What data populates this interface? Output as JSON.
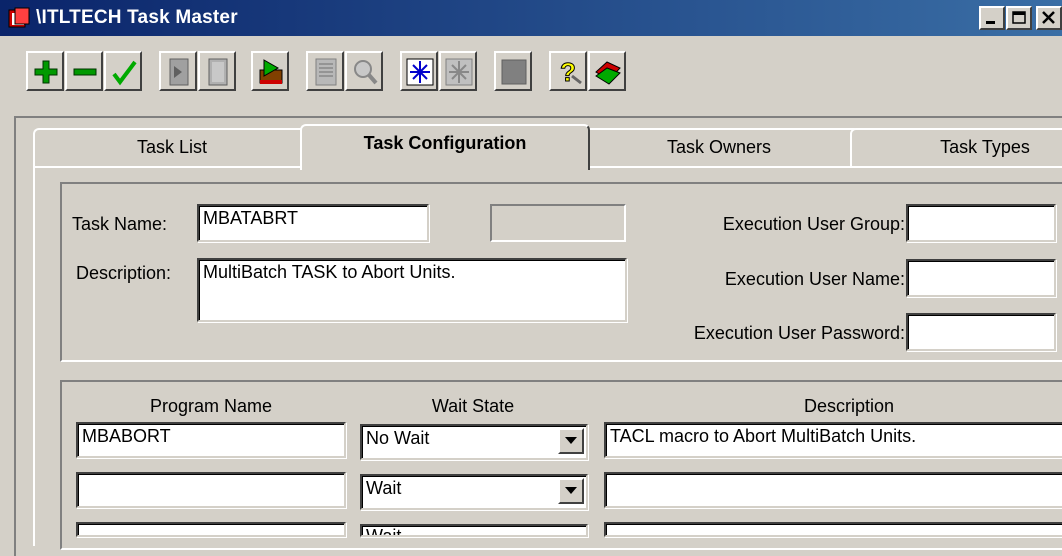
{
  "window": {
    "title": "\\ITLTECH Task Master",
    "controls": [
      "minimize",
      "maximize",
      "close"
    ]
  },
  "toolbar": {
    "buttons": [
      {
        "name": "add",
        "icon": "plus-icon",
        "color": "#009900"
      },
      {
        "name": "delete",
        "icon": "minus-icon",
        "color": "#009900"
      },
      {
        "name": "accept",
        "icon": "checkmark-icon",
        "color": "#009900"
      },
      {
        "name": "copy-disabled",
        "icon": "document-arrow-icon"
      },
      {
        "name": "paste-disabled",
        "icon": "document-icon"
      },
      {
        "name": "run",
        "icon": "run-task-icon"
      },
      {
        "name": "report-disabled",
        "icon": "report-icon"
      },
      {
        "name": "find-disabled",
        "icon": "magnifier-icon"
      },
      {
        "name": "freeze",
        "icon": "snowflake-icon",
        "color": "#0000cc"
      },
      {
        "name": "unfreeze-disabled",
        "icon": "snowflake-gray-icon"
      },
      {
        "name": "stop-disabled",
        "icon": "stop-square-icon"
      },
      {
        "name": "help",
        "icon": "question-icon",
        "color": "#ffff00"
      },
      {
        "name": "exit",
        "icon": "exit-icon",
        "color": "#cc0000"
      }
    ]
  },
  "tabs": [
    {
      "label": "Task List",
      "active": false
    },
    {
      "label": "Task Configuration",
      "active": true
    },
    {
      "label": "Task Owners",
      "active": false
    },
    {
      "label": "Task Types",
      "active": false
    }
  ],
  "task": {
    "name_label": "Task Name:",
    "name_value": "MBATABRT",
    "description_label": "Description:",
    "description_value": "MultiBatch TASK to Abort Units.",
    "exec_group_label": "Execution User Group:",
    "exec_group_value": "",
    "exec_user_label": "Execution User Name:",
    "exec_user_value": "",
    "exec_password_label": "Execution User Password:",
    "exec_password_value": ""
  },
  "programs": {
    "headers": {
      "program_name": "Program Name",
      "wait_state": "Wait State",
      "description": "Description"
    },
    "rows": [
      {
        "program": "MBABORT",
        "wait_state": "No Wait",
        "description": "TACL macro to Abort MultiBatch Units."
      },
      {
        "program": "",
        "wait_state": "Wait",
        "description": ""
      },
      {
        "program": "",
        "wait_state": "Wait",
        "description": ""
      }
    ]
  },
  "colors": {
    "title_bar_start": "#0a246a",
    "title_bar_end": "#3a6ea5",
    "face": "#d4d0c8"
  }
}
